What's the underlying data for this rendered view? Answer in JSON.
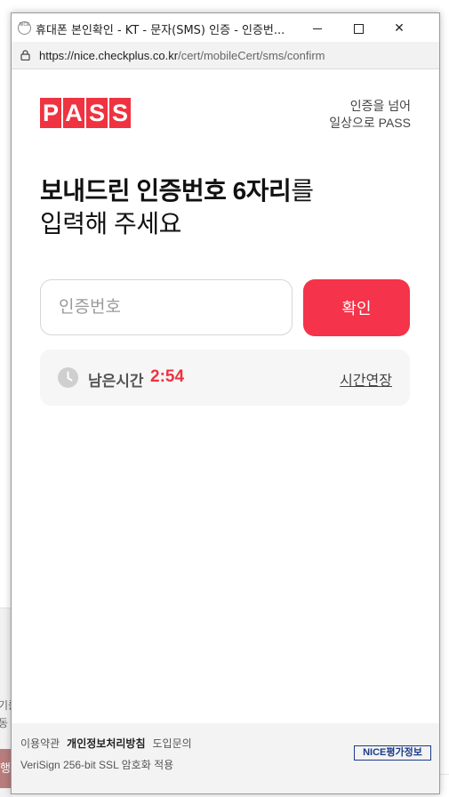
{
  "window": {
    "title": "휴대폰 본인확인 - KT - 문자(SMS) 인증 - 인증번...",
    "favicon_text": "NICE",
    "url_host": "https://nice.checkplus.co.kr",
    "url_path": "/cert/mobileCert/sms/confirm"
  },
  "header": {
    "logo": [
      "P",
      "A",
      "S",
      "S"
    ],
    "slogan_line1": "인증을 넘어",
    "slogan_line2": "일상으로 PASS"
  },
  "main": {
    "heading_bold": "보내드린 인증번호 6자리",
    "heading_suffix": "를",
    "heading_line2": "입력해 주세요",
    "code_input": {
      "placeholder": "인증번호",
      "value": ""
    },
    "confirm_label": "확인",
    "timer": {
      "label": "남은시간",
      "value": "2:54",
      "extend_label": "시간연장"
    }
  },
  "footer": {
    "terms": "이용약관",
    "privacy": "개인정보처리방침",
    "inquiry": "도입문의",
    "ssl": "VeriSign 256-bit SSL 암호화 적용",
    "nice_logo": "NICE평가정보"
  },
  "background": {
    "text1": "기를",
    "text2": "동 항",
    "button": "행"
  },
  "colors": {
    "brand": "#ef3340",
    "confirm": "#f5334a"
  },
  "icons": {
    "lock": "lock-icon",
    "clock": "clock-icon"
  }
}
